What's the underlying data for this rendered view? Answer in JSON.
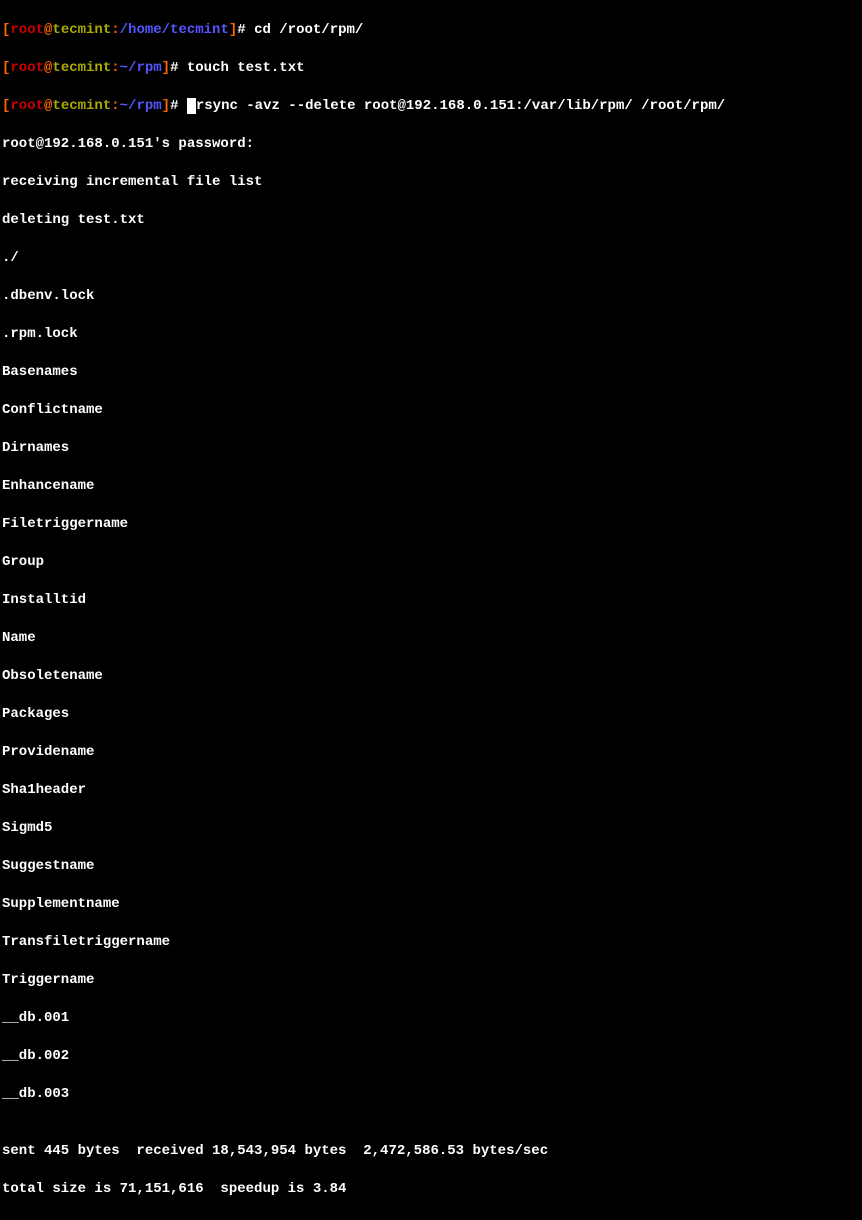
{
  "prompt1": {
    "lb": "[",
    "user": "root",
    "at": "@",
    "host": "tecmint",
    "colon": ":",
    "path": "/home/tecmint",
    "rb": "]",
    "hash": "# ",
    "cmd": "cd /root/rpm/"
  },
  "prompt2": {
    "lb": "[",
    "user": "root",
    "at": "@",
    "host": "tecmint",
    "colon": ":",
    "path": "~/rpm",
    "rb": "]",
    "hash": "# ",
    "cmd": "touch test.txt"
  },
  "prompt3": {
    "lb": "[",
    "user": "root",
    "at": "@",
    "host": "tecmint",
    "colon": ":",
    "path": "~/rpm",
    "rb": "]",
    "hash": "# ",
    "cmd": "rsync -avz --delete root@192.168.0.151:/var/lib/rpm/ /root/rpm/"
  },
  "out": {
    "l1": "root@192.168.0.151's password:",
    "l2": "receiving incremental file list",
    "l3": "deleting test.txt",
    "l4": "./",
    "l5": ".dbenv.lock",
    "l6": ".rpm.lock",
    "l7": "Basenames",
    "l8": "Conflictname",
    "l9": "Dirnames",
    "l10": "Enhancename",
    "l11": "Filetriggername",
    "l12": "Group",
    "l13": "Installtid",
    "l14": "Name",
    "l15": "Obsoletename",
    "l16": "Packages",
    "l17": "Providename",
    "l18": "Sha1header",
    "l19": "Sigmd5",
    "l20": "Suggestname",
    "l21": "Supplementname",
    "l22": "Transfiletriggername",
    "l23": "Triggername",
    "l24": "__db.001",
    "l25": "__db.002",
    "l26": "__db.003",
    "l27": "",
    "l28": "sent 445 bytes  received 18,543,954 bytes  2,472,586.53 bytes/sec",
    "l29": "total size is 71,151,616  speedup is 3.84"
  }
}
